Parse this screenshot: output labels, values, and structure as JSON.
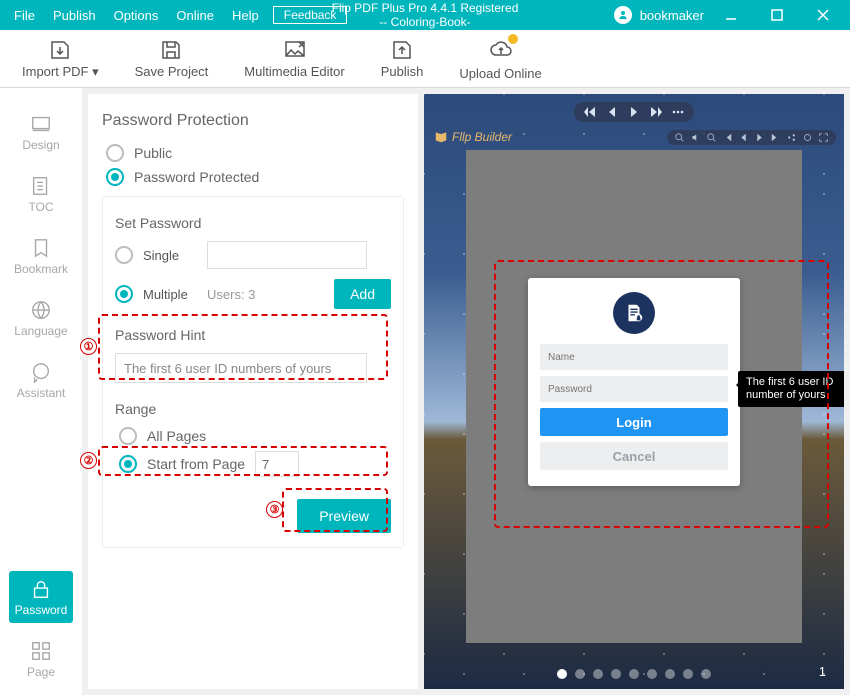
{
  "titlebar": {
    "menu": [
      "File",
      "Publish",
      "Options",
      "Online",
      "Help"
    ],
    "feedback": "Feedback",
    "title_line1": "Flip PDF Plus Pro 4.4.1 Registered",
    "title_line2": "-- Coloring-Book-",
    "username": "bookmaker"
  },
  "toolbar": {
    "import": "Import PDF ▾",
    "save": "Save Project",
    "multimedia": "Multimedia Editor",
    "publish": "Publish",
    "upload": "Upload Online"
  },
  "leftnav": {
    "design": "Design",
    "toc": "TOC",
    "bookmark": "Bookmark",
    "language": "Language",
    "assistant": "Assistant",
    "password": "Password",
    "page": "Page"
  },
  "panel": {
    "heading": "Password Protection",
    "public": "Public",
    "protected": "Password Protected",
    "set_password": "Set Password",
    "single": "Single",
    "multiple": "Multiple",
    "users_label": "Users: 3",
    "add": "Add",
    "hint_label": "Password Hint",
    "hint_value": "The first 6 user ID numbers of yours",
    "range": "Range",
    "all_pages": "All Pages",
    "start_from": "Start from Page",
    "start_value": "7",
    "preview": "Preview"
  },
  "preview": {
    "brand": "Flip Builder",
    "login": "Login",
    "cancel": "Cancel",
    "name_ph": "Name",
    "pwd_ph": "Password",
    "tooltip": "The first 6 user ID number of yours",
    "pagenum": "1"
  }
}
